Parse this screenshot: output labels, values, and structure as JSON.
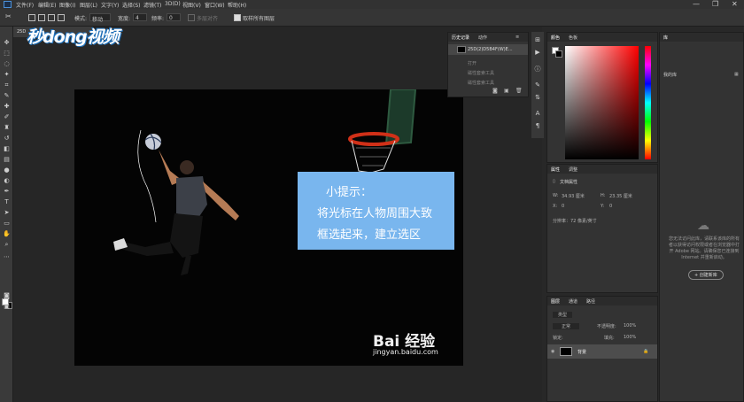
{
  "menubar": {
    "items": [
      "文件(F)",
      "编辑(E)",
      "图像(I)",
      "图层(L)",
      "文字(Y)",
      "选择(S)",
      "滤镜(T)",
      "3D(D)",
      "视图(V)",
      "窗口(W)",
      "帮助(H)"
    ],
    "minimize": "—",
    "restore": "❐",
    "close": "✕"
  },
  "options": {
    "mode_label": "模式:",
    "mode_value": "移动",
    "width_label": "宽度:",
    "width_value": "4",
    "contrast_label": "频率:",
    "contrast_value": "0",
    "check_label": "多层对齐",
    "sample_label": "取样所有图层"
  },
  "document": {
    "tab_title": "25D"
  },
  "watermark": {
    "logo_text": "秒dong视频"
  },
  "tip": {
    "title": "小提示：",
    "line1": "将光标在人物周围大致",
    "line2": "框选起来，建立选区"
  },
  "baidu": {
    "brand": "Bai 经验",
    "url": "jingyan.baidu.com"
  },
  "history": {
    "tabs": [
      "历史记录",
      "动作"
    ],
    "snapshot": "25D(2)D5B4F(W)E...",
    "rows": [
      "打开",
      "磁性套索工具",
      "磁性套索工具"
    ]
  },
  "color_panel": {
    "tabs": [
      "颜色",
      "色板"
    ]
  },
  "properties": {
    "tabs": [
      "属性",
      "调整"
    ],
    "doc_label": "文档属性",
    "w_label": "W:",
    "w_value": "34.93 厘米",
    "h_label": "H:",
    "h_value": "23.35 厘米",
    "x_label": "X:",
    "x_value": "0",
    "y_label": "Y:",
    "y_value": "0",
    "resolution": "分辨率：72 像素/英寸"
  },
  "layers": {
    "tabs": [
      "图层",
      "通道",
      "路径"
    ],
    "kind_label": "类型",
    "normal_label": "正常",
    "opacity_label": "不透明度:",
    "opacity_value": "100%",
    "lock_label": "锁定:",
    "fill_label": "填充:",
    "fill_value": "100%",
    "layer_name": "背景"
  },
  "library": {
    "tab": "库",
    "dropdown": "我的库",
    "message": "您无法访问此库，请联系该库的所有者以获得访问权限或者在浏览器中打开 Adobe 网站。请确保您已连接到 Internet 并重新启动。",
    "create_button": "+ 创建新库"
  }
}
